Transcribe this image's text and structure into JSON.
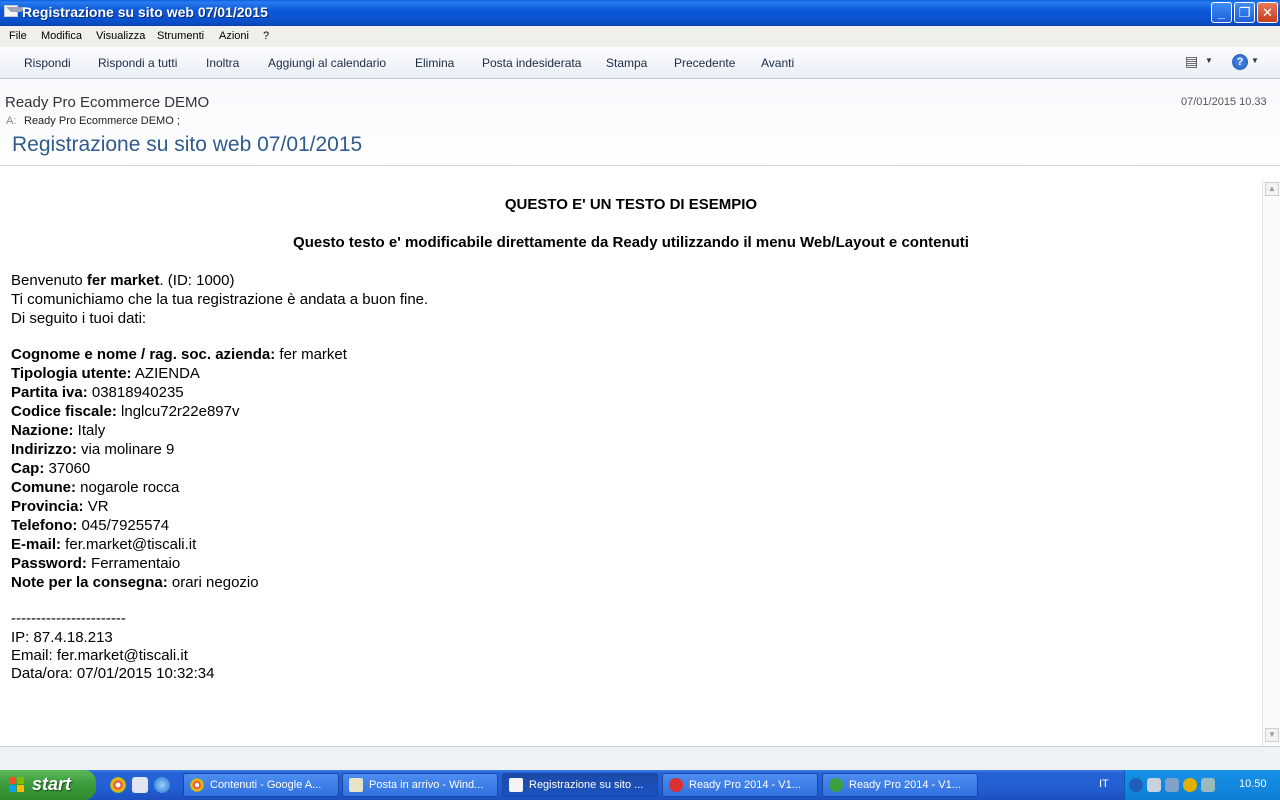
{
  "window": {
    "title": "Registrazione su sito web 07/01/2015"
  },
  "menubar": [
    "File",
    "Modifica",
    "Visualizza",
    "Strumenti",
    "Azioni",
    "?"
  ],
  "toolbar": [
    "Rispondi",
    "Rispondi a tutti",
    "Inoltra",
    "Aggiungi al calendario",
    "Elimina",
    "Posta indesiderata",
    "Stampa",
    "Precedente",
    "Avanti"
  ],
  "header": {
    "sender": "Ready Pro Ecommerce DEMO",
    "date": "07/01/2015 10.33",
    "to_label": "A:",
    "to_value": "Ready Pro Ecommerce DEMO ;",
    "subject": "Registrazione su sito web 07/01/2015"
  },
  "body": {
    "heading1": "QUESTO E' UN TESTO DI ESEMPIO",
    "heading2": "Questo testo e' modificabile direttamente da Ready utilizzando il menu Web/Layout e contenuti",
    "welcome_prefix": "Benvenuto ",
    "welcome_name": "fer market",
    "welcome_suffix": ". (ID: 1000)",
    "line2": "Ti comunichiamo che la tua registrazione è andata a buon fine.",
    "line3": "Di seguito i tuoi dati:",
    "fields": [
      {
        "label": "Cognome e nome / rag. soc. azienda:",
        "value": " fer market"
      },
      {
        "label": "Tipologia utente:",
        "value": " AZIENDA"
      },
      {
        "label": "Partita iva:",
        "value": " 03818940235"
      },
      {
        "label": "Codice fiscale:",
        "value": " lnglcu72r22e897v"
      },
      {
        "label": "Nazione:",
        "value": " Italy"
      },
      {
        "label": "Indirizzo:",
        "value": " via molinare 9"
      },
      {
        "label": "Cap:",
        "value": " 37060"
      },
      {
        "label": "Comune:",
        "value": " nogarole rocca"
      },
      {
        "label": "Provincia:",
        "value": " VR"
      },
      {
        "label": "Telefono:",
        "value": " 045/7925574"
      },
      {
        "label": "E-mail:",
        "value": " fer.market@tiscali.it"
      },
      {
        "label": "Password:",
        "value": " Ferramentaio"
      },
      {
        "label": "Note per la consegna:",
        "value": " orari negozio"
      }
    ],
    "separator": "-----------------------",
    "ip": "IP: 87.4.18.213",
    "email": "Email: fer.market@tiscali.it",
    "datetime": "Data/ora: 07/01/2015 10:32:34"
  },
  "taskbar": {
    "start": "start",
    "tasks": [
      "Contenuti - Google A...",
      "Posta in arrivo - Wind...",
      "Registrazione su sito ...",
      "Ready Pro 2014 - V1...",
      "Ready Pro 2014 - V1..."
    ],
    "lang": "IT",
    "clock": "10.50"
  },
  "icons": {
    "app": "envelope-icon",
    "help": "help-icon",
    "view": "view-options-icon"
  }
}
